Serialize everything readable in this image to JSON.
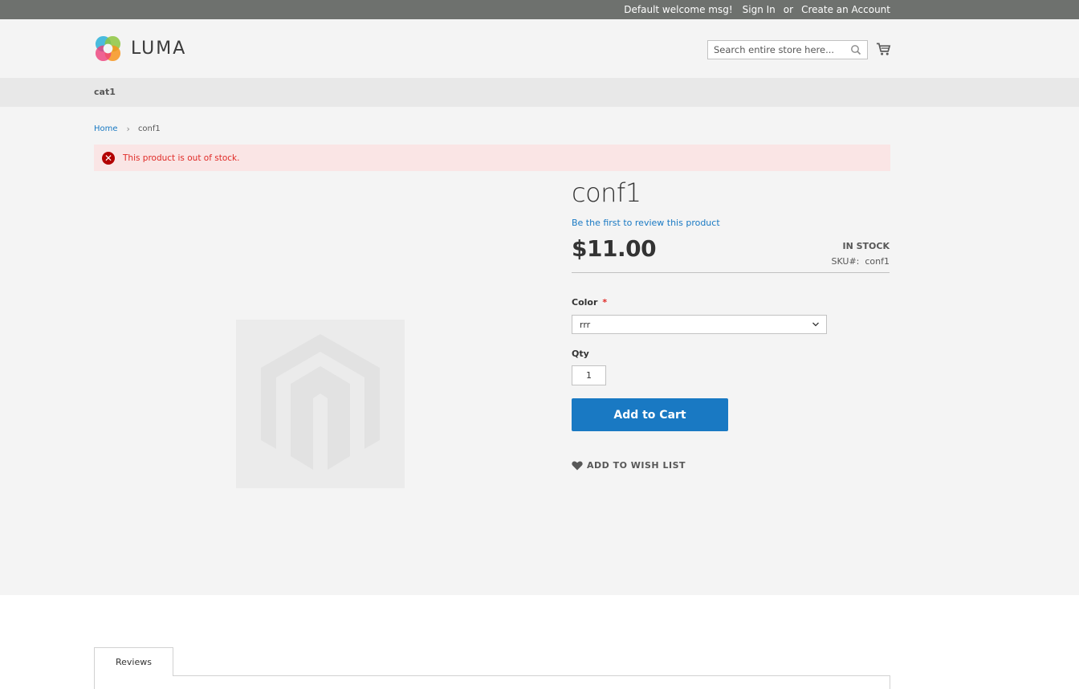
{
  "topbar": {
    "welcome": "Default welcome msg!",
    "sign_in": "Sign In",
    "or": "or",
    "create_account": "Create an Account"
  },
  "header": {
    "logo_text": "LUMA",
    "search_placeholder": "Search entire store here...",
    "search_icon": "search-icon",
    "cart_icon": "cart-icon"
  },
  "nav": {
    "items": [
      {
        "label": "cat1"
      }
    ]
  },
  "breadcrumbs": {
    "home": "Home",
    "current": "conf1"
  },
  "message": {
    "type": "error",
    "text": "This product is out of stock."
  },
  "product": {
    "name": "conf1",
    "review_link": "Be the first to review this product",
    "price": "$11.00",
    "stock": "IN STOCK",
    "sku_label": "SKU#:",
    "sku": "conf1",
    "color_label": "Color",
    "required_mark": "*",
    "color_selected": "rrr",
    "qty_label": "Qty",
    "qty_value": "1",
    "add_to_cart": "Add to Cart",
    "wishlist": "ADD TO WISH LIST"
  },
  "tabs": [
    {
      "label": "Reviews"
    }
  ],
  "colors": {
    "accent": "#1979c3",
    "error_text": "#e02b27",
    "error_bg": "#fae5e5",
    "topbar": "#6e716e"
  }
}
